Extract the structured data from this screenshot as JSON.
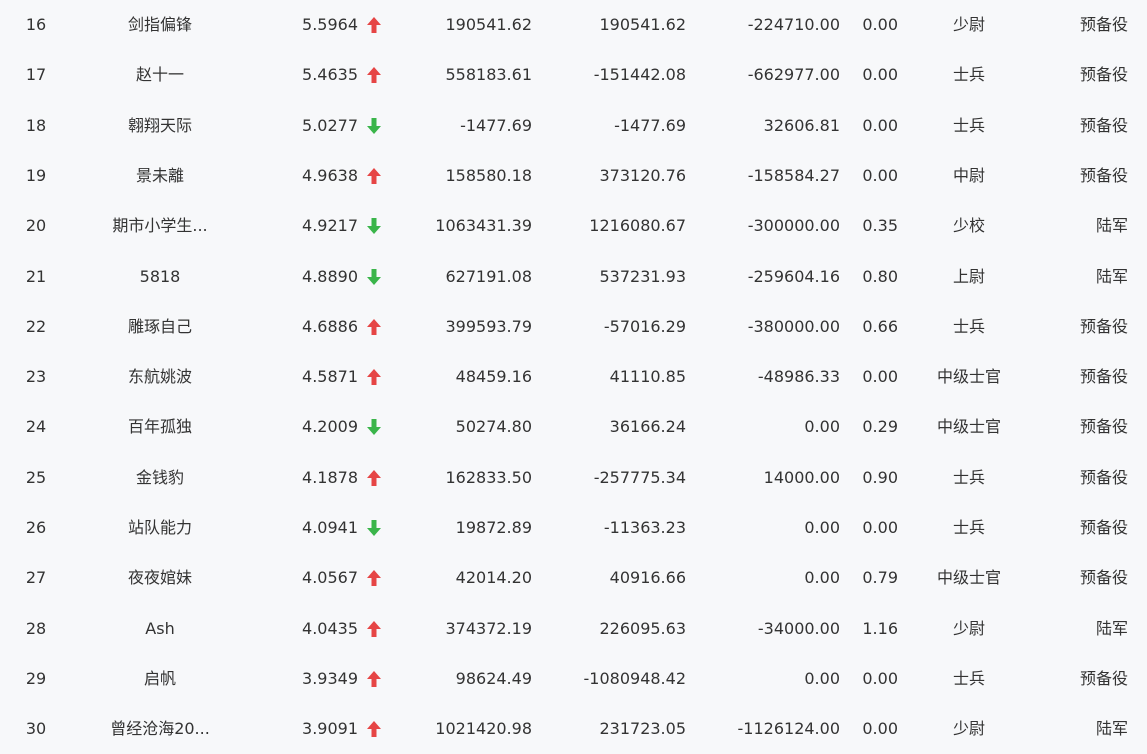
{
  "colors": {
    "up": "#e64545",
    "down": "#3ab54a",
    "text": "#333333",
    "background": "#f7f8fa"
  },
  "rows": [
    {
      "rank": "16",
      "name": "剑指偏锋",
      "ratio": "5.5964",
      "trend": "up",
      "v1": "190541.62",
      "v2": "190541.62",
      "v3": "-224710.00",
      "v4": "0.00",
      "mil_rank": "少尉",
      "branch": "预备役"
    },
    {
      "rank": "17",
      "name": "赵十一",
      "ratio": "5.4635",
      "trend": "up",
      "v1": "558183.61",
      "v2": "-151442.08",
      "v3": "-662977.00",
      "v4": "0.00",
      "mil_rank": "士兵",
      "branch": "预备役"
    },
    {
      "rank": "18",
      "name": "翱翔天际",
      "ratio": "5.0277",
      "trend": "down",
      "v1": "-1477.69",
      "v2": "-1477.69",
      "v3": "32606.81",
      "v4": "0.00",
      "mil_rank": "士兵",
      "branch": "预备役"
    },
    {
      "rank": "19",
      "name": "景未離",
      "ratio": "4.9638",
      "trend": "up",
      "v1": "158580.18",
      "v2": "373120.76",
      "v3": "-158584.27",
      "v4": "0.00",
      "mil_rank": "中尉",
      "branch": "预备役"
    },
    {
      "rank": "20",
      "name": "期市小学生...",
      "ratio": "4.9217",
      "trend": "down",
      "v1": "1063431.39",
      "v2": "1216080.67",
      "v3": "-300000.00",
      "v4": "0.35",
      "mil_rank": "少校",
      "branch": "陆军"
    },
    {
      "rank": "21",
      "name": "5818",
      "ratio": "4.8890",
      "trend": "down",
      "v1": "627191.08",
      "v2": "537231.93",
      "v3": "-259604.16",
      "v4": "0.80",
      "mil_rank": "上尉",
      "branch": "陆军"
    },
    {
      "rank": "22",
      "name": "雕琢自己",
      "ratio": "4.6886",
      "trend": "up",
      "v1": "399593.79",
      "v2": "-57016.29",
      "v3": "-380000.00",
      "v4": "0.66",
      "mil_rank": "士兵",
      "branch": "预备役"
    },
    {
      "rank": "23",
      "name": "东航姚波",
      "ratio": "4.5871",
      "trend": "up",
      "v1": "48459.16",
      "v2": "41110.85",
      "v3": "-48986.33",
      "v4": "0.00",
      "mil_rank": "中级士官",
      "branch": "预备役"
    },
    {
      "rank": "24",
      "name": "百年孤独",
      "ratio": "4.2009",
      "trend": "down",
      "v1": "50274.80",
      "v2": "36166.24",
      "v3": "0.00",
      "v4": "0.29",
      "mil_rank": "中级士官",
      "branch": "预备役"
    },
    {
      "rank": "25",
      "name": "金钱豹",
      "ratio": "4.1878",
      "trend": "up",
      "v1": "162833.50",
      "v2": "-257775.34",
      "v3": "14000.00",
      "v4": "0.90",
      "mil_rank": "士兵",
      "branch": "预备役"
    },
    {
      "rank": "26",
      "name": "站队能力",
      "ratio": "4.0941",
      "trend": "down",
      "v1": "19872.89",
      "v2": "-11363.23",
      "v3": "0.00",
      "v4": "0.00",
      "mil_rank": "士兵",
      "branch": "预备役"
    },
    {
      "rank": "27",
      "name": "夜夜婠妹",
      "ratio": "4.0567",
      "trend": "up",
      "v1": "42014.20",
      "v2": "40916.66",
      "v3": "0.00",
      "v4": "0.79",
      "mil_rank": "中级士官",
      "branch": "预备役"
    },
    {
      "rank": "28",
      "name": "Ash",
      "ratio": "4.0435",
      "trend": "up",
      "v1": "374372.19",
      "v2": "226095.63",
      "v3": "-34000.00",
      "v4": "1.16",
      "mil_rank": "少尉",
      "branch": "陆军"
    },
    {
      "rank": "29",
      "name": "启帆",
      "ratio": "3.9349",
      "trend": "up",
      "v1": "98624.49",
      "v2": "-1080948.42",
      "v3": "0.00",
      "v4": "0.00",
      "mil_rank": "士兵",
      "branch": "预备役"
    },
    {
      "rank": "30",
      "name": "曾经沧海20...",
      "ratio": "3.9091",
      "trend": "up",
      "v1": "1021420.98",
      "v2": "231723.05",
      "v3": "-1126124.00",
      "v4": "0.00",
      "mil_rank": "少尉",
      "branch": "陆军"
    }
  ]
}
